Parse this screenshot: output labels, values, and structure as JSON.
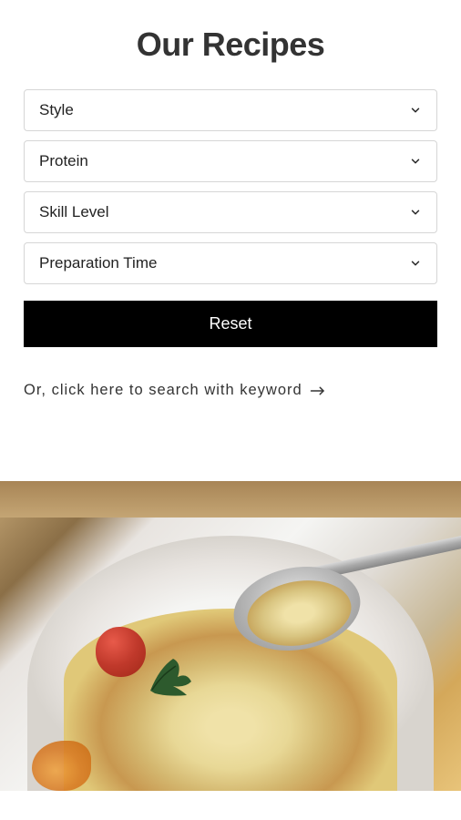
{
  "page": {
    "title": "Our Recipes"
  },
  "filters": [
    {
      "label": "Style"
    },
    {
      "label": "Protein"
    },
    {
      "label": "Skill Level"
    },
    {
      "label": "Preparation Time"
    }
  ],
  "reset_button": "Reset",
  "search_link": "Or, click here to search with keyword"
}
